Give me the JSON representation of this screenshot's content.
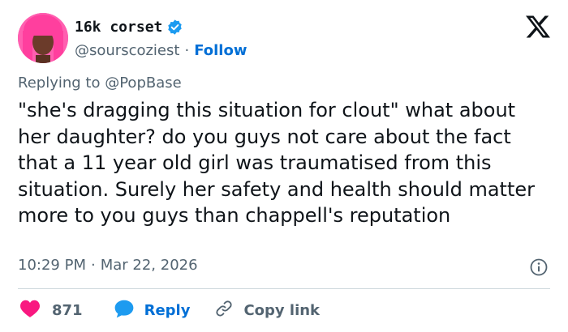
{
  "author": {
    "display_name": "16k corset",
    "handle": "@sourscoziest",
    "separator": "·",
    "follow_label": "Follow",
    "verified": true
  },
  "reply_context": {
    "prefix": "Replying to",
    "mention": "@PopBase"
  },
  "tweet": {
    "text": "\"she's dragging this situation for clout\" what about her daughter? do you guys not care about the fact that a 11 year old girl was traumatised from this situation. Surely her safety and health should matter more to you guys than chappell's reputation"
  },
  "meta": {
    "time": "10:29 PM",
    "separator": "·",
    "date": "Mar 22, 2026"
  },
  "actions": {
    "like_count": "871",
    "reply_label": "Reply",
    "copy_label": "Copy link"
  },
  "colors": {
    "like_red": "#f91880",
    "link_blue": "#006fd6",
    "verified_blue": "#1d9bf0",
    "secondary_text": "#536471",
    "avatar_pink": "#ff4fa8"
  },
  "icons": {
    "brand": "x-logo-icon",
    "verified": "verified-badge-icon",
    "info": "info-icon",
    "like": "heart-icon",
    "reply": "reply-bubble-icon",
    "copy": "link-icon"
  }
}
